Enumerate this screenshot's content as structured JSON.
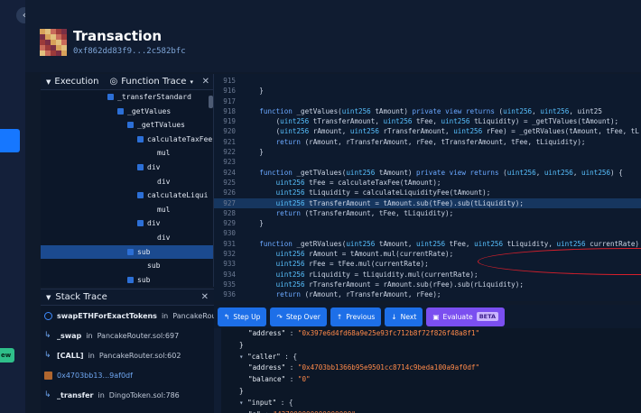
{
  "header": {
    "back_icon": "chevron-left-icon",
    "title": "Transaction",
    "hash": "0xf862dd83f9...2c582bfc"
  },
  "rail": {
    "badge_text": "ew"
  },
  "execution_panel": {
    "tab_execution": "Execution",
    "tab_function_trace": "Function Trace",
    "close": "✕",
    "rows": [
      {
        "label": "_transferStandard",
        "indent": 5,
        "toggle": true,
        "selected": false
      },
      {
        "label": "_getValues",
        "indent": 6,
        "toggle": true,
        "selected": false
      },
      {
        "label": "_getTValues",
        "indent": 7,
        "toggle": true,
        "selected": false
      },
      {
        "label": "calculateTaxFee",
        "indent": 8,
        "toggle": true,
        "selected": false
      },
      {
        "label": "mul",
        "indent": 9,
        "toggle": false,
        "selected": false
      },
      {
        "label": "div",
        "indent": 8,
        "toggle": true,
        "selected": false
      },
      {
        "label": "div",
        "indent": 9,
        "toggle": false,
        "selected": false
      },
      {
        "label": "calculateLiqui",
        "indent": 8,
        "toggle": true,
        "selected": false
      },
      {
        "label": "mul",
        "indent": 9,
        "toggle": false,
        "selected": false
      },
      {
        "label": "div",
        "indent": 8,
        "toggle": true,
        "selected": false
      },
      {
        "label": "div",
        "indent": 9,
        "toggle": false,
        "selected": false
      },
      {
        "label": "sub",
        "indent": 7,
        "toggle": true,
        "selected": true
      },
      {
        "label": "sub",
        "indent": 8,
        "toggle": false,
        "selected": false
      },
      {
        "label": "sub",
        "indent": 7,
        "toggle": true,
        "selected": false
      },
      {
        "label": "sub",
        "indent": 8,
        "toggle": false,
        "selected": false
      }
    ]
  },
  "code": {
    "lines": [
      {
        "n": "915",
        "text": ""
      },
      {
        "n": "916",
        "text": "    }"
      },
      {
        "n": "917",
        "text": ""
      },
      {
        "n": "918",
        "text": "    function _getValues(uint256 tAmount) private view returns (uint256, uint256, uint25"
      },
      {
        "n": "919",
        "text": "        (uint256 tTransferAmount, uint256 tFee, uint256 tLiquidity) = _getTValues(tAmount);"
      },
      {
        "n": "920",
        "text": "        (uint256 rAmount, uint256 rTransferAmount, uint256 rFee) = _getRValues(tAmount, tFee, tL"
      },
      {
        "n": "921",
        "text": "        return (rAmount, rTransferAmount, rFee, tTransferAmount, tFee, tLiquidity);"
      },
      {
        "n": "922",
        "text": "    }"
      },
      {
        "n": "923",
        "text": ""
      },
      {
        "n": "924",
        "text": "    function _getTValues(uint256 tAmount) private view returns (uint256, uint256, uint256) {"
      },
      {
        "n": "925",
        "text": "        uint256 tFee = calculateTaxFee(tAmount);"
      },
      {
        "n": "926",
        "text": "        uint256 tLiquidity = calculateLiquidityFee(tAmount);"
      },
      {
        "n": "927",
        "text": "        uint256 tTransferAmount = tAmount.sub(tFee).sub(tLiquidity);"
      },
      {
        "n": "928",
        "text": "        return (tTransferAmount, tFee, tLiquidity);"
      },
      {
        "n": "929",
        "text": "    }"
      },
      {
        "n": "930",
        "text": ""
      },
      {
        "n": "931",
        "text": "    function _getRValues(uint256 tAmount, uint256 tFee, uint256 tLiquidity, uint256 currentRate)"
      },
      {
        "n": "932",
        "text": "        uint256 rAmount = tAmount.mul(currentRate);"
      },
      {
        "n": "933",
        "text": "        uint256 rFee = tFee.mul(currentRate);"
      },
      {
        "n": "934",
        "text": "        uint256 rLiquidity = tLiquidity.mul(currentRate);"
      },
      {
        "n": "935",
        "text": "        uint256 rTransferAmount = rAmount.sub(rFee).sub(rLiquidity);"
      },
      {
        "n": "936",
        "text": "        return (rAmount, rTransferAmount, rFee);"
      },
      {
        "n": "937",
        "text": "    }"
      },
      {
        "n": "938",
        "text": ""
      }
    ],
    "highlight_line": "927"
  },
  "stack_trace": {
    "title": "Stack Trace",
    "close": "✕",
    "items": [
      {
        "fn": "swapETHForExactTokens",
        "in": "in",
        "file": "PancakeRouter",
        "icon": "circle-icon",
        "type": "fn"
      },
      {
        "fn": "_swap",
        "in": "in",
        "file": "PancakeRouter.sol:697",
        "icon": "return-arrow-icon",
        "type": "fn"
      },
      {
        "fn": "[CALL]",
        "in": "in",
        "file": "PancakeRouter.sol:602",
        "icon": "return-arrow-icon",
        "type": "fn"
      },
      {
        "fn": "0x4703bb13...9af0df",
        "in": "",
        "file": "",
        "icon": "contract-avatar-icon",
        "type": "addr"
      },
      {
        "fn": "_transfer",
        "in": "in",
        "file": "DingoToken.sol:786",
        "icon": "return-arrow-icon",
        "type": "fn"
      }
    ]
  },
  "toolbar": {
    "step_up": "Step Up",
    "step_over": "Step Over",
    "previous": "Previous",
    "next": "Next",
    "evaluate": "Evaluate",
    "beta": "BETA"
  },
  "json_view": {
    "lines": [
      {
        "indent": 2,
        "key": "\"address\"",
        "sep": " : ",
        "value": "\"0x397e6d4fd68a9e25e93fc712b8f72f826f48a8f1\"",
        "arrow": false
      },
      {
        "indent": 1,
        "key": "}",
        "sep": "",
        "value": "",
        "arrow": false
      },
      {
        "indent": 1,
        "key": "\"caller\"",
        "sep": " : {",
        "value": "",
        "arrow": true
      },
      {
        "indent": 2,
        "key": "\"address\"",
        "sep": " : ",
        "value": "\"0x4703bb1366b95e9501cc8714c9beda100a9af0df\"",
        "arrow": false
      },
      {
        "indent": 2,
        "key": "\"balance\"",
        "sep": " : ",
        "value": "\"0\"",
        "arrow": false
      },
      {
        "indent": 1,
        "key": "}",
        "sep": "",
        "value": "",
        "arrow": false
      },
      {
        "indent": 1,
        "key": "\"input\"",
        "sep": " : {",
        "value": "",
        "arrow": true
      },
      {
        "indent": 2,
        "key": "\"a\"",
        "sep": " : ",
        "value": "\"427000000000000000\"",
        "arrow": false
      }
    ]
  }
}
